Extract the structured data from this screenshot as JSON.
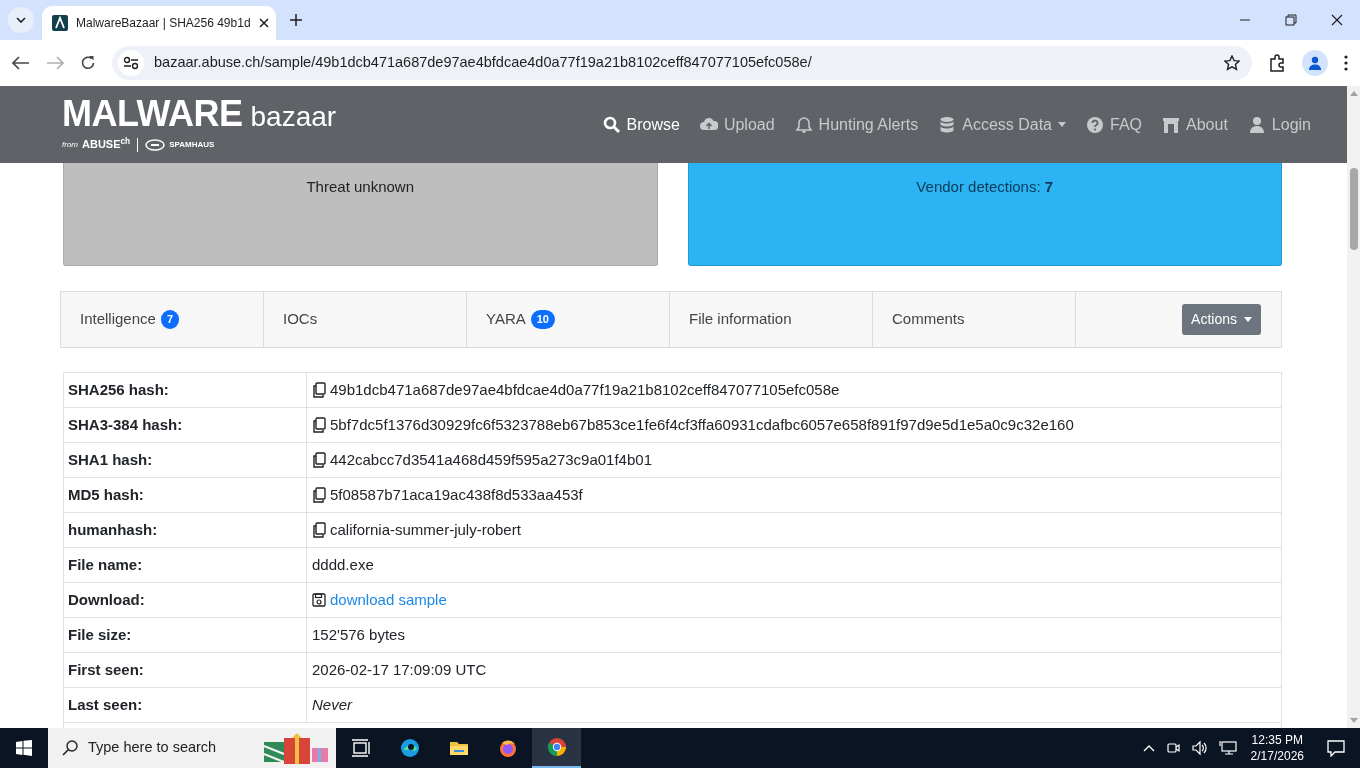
{
  "browser": {
    "tab_title": "MalwareBazaar | SHA256 49b1d",
    "url": "bazaar.abuse.ch/sample/49b1dcb471a687de97ae4bfdcae4d0a77f19a21b8102ceff847077105efc058e/"
  },
  "header": {
    "logo_main": "MALWARE",
    "logo_sub": "bazaar",
    "byline_from": "from",
    "byline_abuse": "ABUSE",
    "byline_ch": "ch",
    "byline_spamhaus": "SPAMHAUS",
    "nav": [
      {
        "label": "Browse",
        "kind": "search",
        "active": true,
        "dropdown": false
      },
      {
        "label": "Upload",
        "kind": "cloud",
        "active": false,
        "dropdown": false
      },
      {
        "label": "Hunting Alerts",
        "kind": "bell",
        "active": false,
        "dropdown": false
      },
      {
        "label": "Access Data",
        "kind": "database",
        "active": false,
        "dropdown": true
      },
      {
        "label": "FAQ",
        "kind": "question",
        "active": false,
        "dropdown": false
      },
      {
        "label": "About",
        "kind": "building",
        "active": false,
        "dropdown": false
      },
      {
        "label": "Login",
        "kind": "user",
        "active": false,
        "dropdown": false
      }
    ]
  },
  "cards": [
    {
      "kind": "unknown",
      "text": "Threat unknown"
    },
    {
      "kind": "detections",
      "text": "Vendor detections: **7**"
    }
  ],
  "tabs": [
    {
      "label": "Intelligence",
      "badge": "7"
    },
    {
      "label": "IOCs"
    },
    {
      "label": "YARA",
      "badge": "10"
    },
    {
      "label": "File information"
    },
    {
      "label": "Comments"
    }
  ],
  "actions_button": "Actions",
  "table": {
    "rows": [
      {
        "label": "SHA256 hash:",
        "value": "49b1dcb471a687de97ae4bfdcae4d0a77f19a21b8102ceff847077105efc058e",
        "kind": "copy"
      },
      {
        "label": "SHA3-384 hash:",
        "value": "5bf7dc5f1376d30929fc6f5323788eb67b853ce1fe6f4cf3ffa60931cdafbc6057e658f891f97d9e5d1e5a0c9c32e160",
        "kind": "copy"
      },
      {
        "label": "SHA1 hash:",
        "value": "442cabcc7d3541a468d459f595a273c9a01f4b01",
        "kind": "copy"
      },
      {
        "label": "MD5 hash:",
        "value": "5f08587b71aca19ac438f8d533aa453f",
        "kind": "copy"
      },
      {
        "label": "humanhash:",
        "value": "california-summer-july-robert",
        "kind": "copy"
      },
      {
        "label": "File name:",
        "value": "dddd.exe",
        "kind": "text"
      },
      {
        "label": "Download:",
        "value": "download sample",
        "kind": "link"
      },
      {
        "label": "File size:",
        "value": "152'576 bytes",
        "kind": "text"
      },
      {
        "label": "First seen:",
        "value": "2026-02-17 17:09:09 UTC",
        "kind": "text"
      },
      {
        "label": "Last seen:",
        "value": "Never",
        "kind": "italic"
      }
    ]
  },
  "taskbar": {
    "search_placeholder": "Type here to search",
    "apps": [
      {
        "kind": "taskview",
        "active": false
      },
      {
        "kind": "edge",
        "active": false
      },
      {
        "kind": "explorer",
        "active": false
      },
      {
        "kind": "firefox",
        "active": false
      },
      {
        "kind": "chrome",
        "active": true
      }
    ],
    "time": "12:35 PM",
    "date": "2/17/2026"
  }
}
